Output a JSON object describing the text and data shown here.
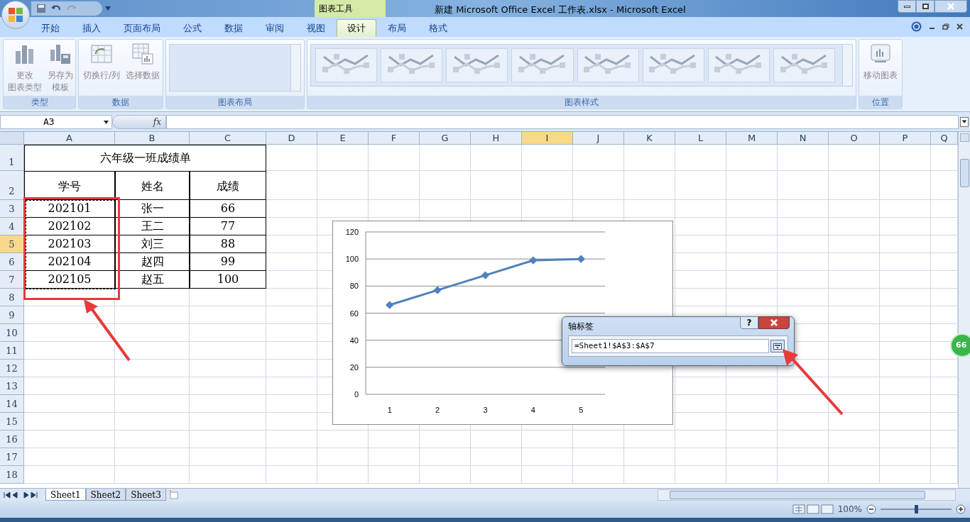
{
  "title_bar": {
    "context_label": "图表工具",
    "title": "新建 Microsoft Office Excel 工作表.xlsx - Microsoft Excel"
  },
  "ribbon_tabs": [
    {
      "label": "开始",
      "selected": false
    },
    {
      "label": "插入",
      "selected": false
    },
    {
      "label": "页面布局",
      "selected": false
    },
    {
      "label": "公式",
      "selected": false
    },
    {
      "label": "数据",
      "selected": false
    },
    {
      "label": "审阅",
      "selected": false
    },
    {
      "label": "视图",
      "selected": false
    },
    {
      "label": "设计",
      "selected": true
    },
    {
      "label": "布局",
      "selected": false
    },
    {
      "label": "格式",
      "selected": false
    }
  ],
  "ribbon_groups": [
    {
      "label": "类型",
      "kind": "buttons",
      "buttons": [
        {
          "lines": [
            "更改",
            "图表类型"
          ]
        },
        {
          "lines": [
            "另存为",
            "模板"
          ]
        }
      ]
    },
    {
      "label": "数据",
      "kind": "buttons",
      "buttons": [
        {
          "lines": [
            "切换行/列"
          ]
        },
        {
          "lines": [
            "选择数据"
          ]
        }
      ]
    },
    {
      "label": "图表布局",
      "kind": "empty_gallery"
    },
    {
      "label": "图表样式",
      "kind": "style_gallery"
    },
    {
      "label": "位置",
      "kind": "buttons",
      "buttons": [
        {
          "lines": [
            "移动图表"
          ]
        }
      ]
    }
  ],
  "formula_bar": {
    "name_box": "A3",
    "fx": "fx"
  },
  "columns": [
    {
      "label": "A",
      "selected": false
    },
    {
      "label": "B",
      "selected": false
    },
    {
      "label": "C",
      "selected": false
    },
    {
      "label": "D",
      "selected": false
    },
    {
      "label": "E",
      "selected": false
    },
    {
      "label": "F",
      "selected": false
    },
    {
      "label": "G",
      "selected": false
    },
    {
      "label": "H",
      "selected": false
    },
    {
      "label": "I",
      "selected": true
    },
    {
      "label": "J",
      "selected": false
    },
    {
      "label": "K",
      "selected": false
    },
    {
      "label": "L",
      "selected": false
    },
    {
      "label": "M",
      "selected": false
    },
    {
      "label": "N",
      "selected": false
    },
    {
      "label": "O",
      "selected": false
    },
    {
      "label": "P",
      "selected": false
    },
    {
      "label": "Q",
      "selected": false
    }
  ],
  "rows": [
    {
      "label": "1",
      "selected": false
    },
    {
      "label": "2",
      "selected": false
    },
    {
      "label": "3",
      "selected": false
    },
    {
      "label": "4",
      "selected": false
    },
    {
      "label": "5",
      "selected": true
    },
    {
      "label": "6",
      "selected": false
    },
    {
      "label": "7",
      "selected": false
    },
    {
      "label": "8",
      "selected": false
    },
    {
      "label": "9",
      "selected": false
    },
    {
      "label": "10",
      "selected": false
    },
    {
      "label": "11",
      "selected": false
    },
    {
      "label": "12",
      "selected": false
    },
    {
      "label": "13",
      "selected": false
    },
    {
      "label": "14",
      "selected": false
    },
    {
      "label": "15",
      "selected": false
    },
    {
      "label": "16",
      "selected": false
    },
    {
      "label": "17",
      "selected": false
    },
    {
      "label": "18",
      "selected": false
    }
  ],
  "sheet": {
    "title": "六年级一班成绩单",
    "header": [
      "学号",
      "姓名",
      "成绩"
    ],
    "data": [
      [
        "202101",
        "张一",
        "66"
      ],
      [
        "202102",
        "王二",
        "77"
      ],
      [
        "202103",
        "刘三",
        "88"
      ],
      [
        "202104",
        "赵四",
        "99"
      ],
      [
        "202105",
        "赵五",
        "100"
      ]
    ]
  },
  "chart": {
    "chart_data": {
      "type": "line",
      "categories": [
        "1",
        "2",
        "3",
        "4",
        "5"
      ],
      "ylim": [
        0,
        120
      ],
      "yticks": [
        0,
        20,
        40,
        60,
        80,
        100,
        120
      ],
      "grid": true,
      "series": [
        {
          "color": "#4f81bd",
          "marker": "diamond",
          "values": [
            66,
            77,
            88,
            99,
            100
          ]
        }
      ]
    }
  },
  "dialog": {
    "title": "轴标签",
    "help": "?",
    "value": "=Sheet1!$A$3:$A$7"
  },
  "side_badge": "66",
  "sheet_tabs": [
    {
      "label": "Sheet1",
      "selected": true
    },
    {
      "label": "Sheet2",
      "selected": false
    },
    {
      "label": "Sheet3",
      "selected": false
    }
  ],
  "status_bar": {
    "zoom": "100%",
    "zoom_slider": {
      "level": 0.5
    }
  }
}
